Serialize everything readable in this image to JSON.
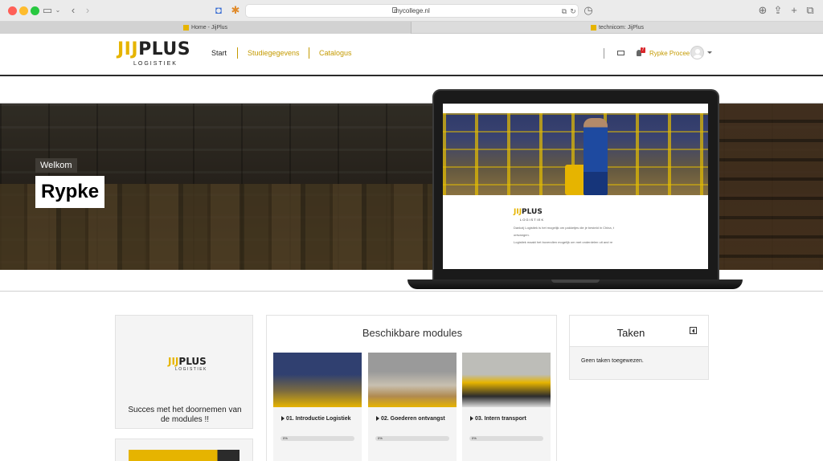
{
  "browser": {
    "url": "mycollege.nl",
    "tabs": [
      {
        "label": "Home - JijPlus"
      },
      {
        "label": "technicom: JijPlus"
      }
    ]
  },
  "header": {
    "logo": {
      "prefix": "JIJ",
      "suffix": "PLUS",
      "sub": "LOGISTIEK"
    },
    "nav": [
      {
        "label": "Start"
      },
      {
        "label": "Studiegegevens"
      },
      {
        "label": "Catalogus"
      }
    ],
    "notifications_badge": "7",
    "user_name": "Rypke Procee"
  },
  "hero": {
    "welcome_label": "Welkom",
    "user_first_name": "Rypke",
    "screen": {
      "logo_prefix": "JIJ",
      "logo_suffix": "PLUS",
      "logo_sub": "LOGISTIEK",
      "line1": "Dankzij Logistiek is het mogelijk om pakketjes die je besteld in China,  t",
      "line2": "ontvangen.",
      "line3": "Logistiek maakt het bovendien mogelijk om met onderdelen uit and  re"
    }
  },
  "left_card": {
    "logo_prefix": "JIJ",
    "logo_suffix": "PLUS",
    "logo_sub": "LOGISTIEK",
    "message": "Succes met het doornemen van de modules !!"
  },
  "modules": {
    "title": "Beschikbare modules",
    "items": [
      {
        "title": "01. Introductie Logistiek",
        "progress_label": "0%",
        "progress": 0
      },
      {
        "title": "02. Goederen ontvangst",
        "progress_label": "0%",
        "progress": 0
      },
      {
        "title": "03. Intern transport",
        "progress_label": "0%",
        "progress": 0
      }
    ]
  },
  "tasks": {
    "title": "Taken",
    "empty_text": "Geen taken toegewezen."
  },
  "colors": {
    "brand_yellow": "#e6b400",
    "link_gold": "#c49a00",
    "badge_red": "#d9262b"
  }
}
